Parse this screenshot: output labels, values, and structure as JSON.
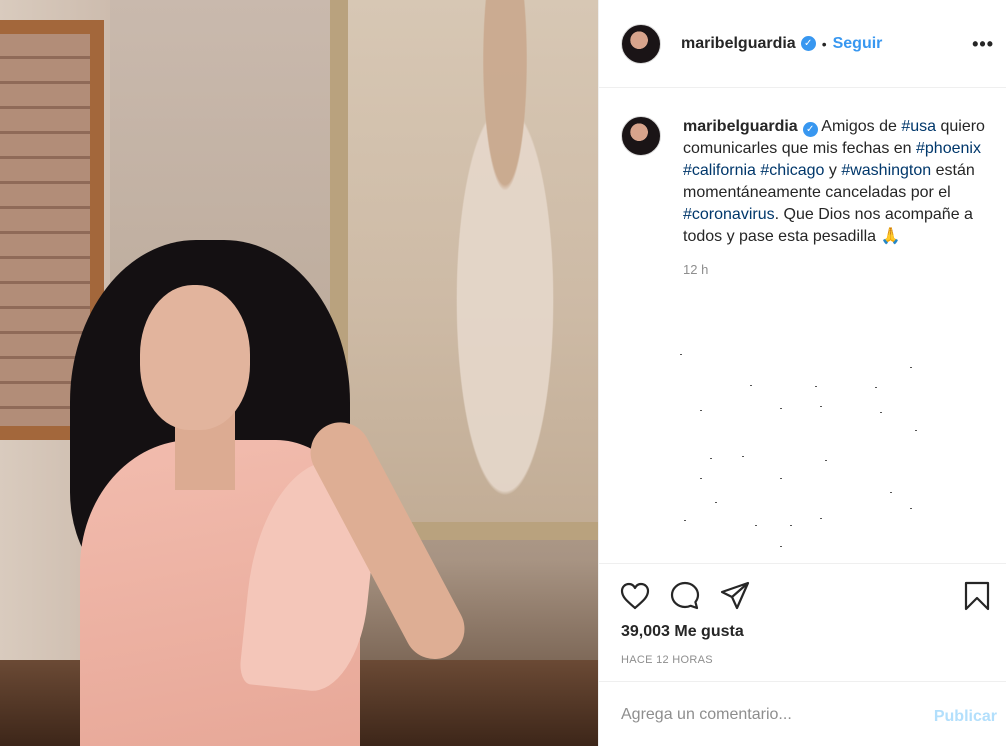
{
  "header": {
    "username": "maribelguardia",
    "verified_mark": "✓",
    "separator": "•",
    "follow_label": "Seguir",
    "more_label": "•••"
  },
  "caption": {
    "username": "maribelguardia",
    "verified_mark": "✓",
    "t1": "Amigos de ",
    "tag_usa": "#usa",
    "t2": " quiero comunicarles que mis fechas en ",
    "tag_phoenix": "#phoenix",
    "tag_california": "#california",
    "tag_chicago": "#chicago",
    "t3": " y ",
    "tag_washington": "#washington",
    "t4": " están momentáneamente canceladas por el ",
    "tag_coronavirus": "#coronavirus",
    "t5": ". Que Dios nos acompañe a todos y pase esta pesadilla ",
    "emoji": "🙏",
    "time": "12 h"
  },
  "actions": {
    "likes": "39,003 Me gusta",
    "time_ago": "HACE 12 HORAS"
  },
  "comment": {
    "placeholder": "Agrega un comentario...",
    "publish_label": "Publicar"
  },
  "icons": {
    "like": "heart-icon",
    "comment": "comment-icon",
    "share": "share-icon",
    "save": "bookmark-icon",
    "more": "more-icon"
  },
  "colors": {
    "link": "#3897f0",
    "hashtag": "#00376b",
    "muted": "#8e8e8e",
    "publish_disabled": "#b2dffc"
  }
}
